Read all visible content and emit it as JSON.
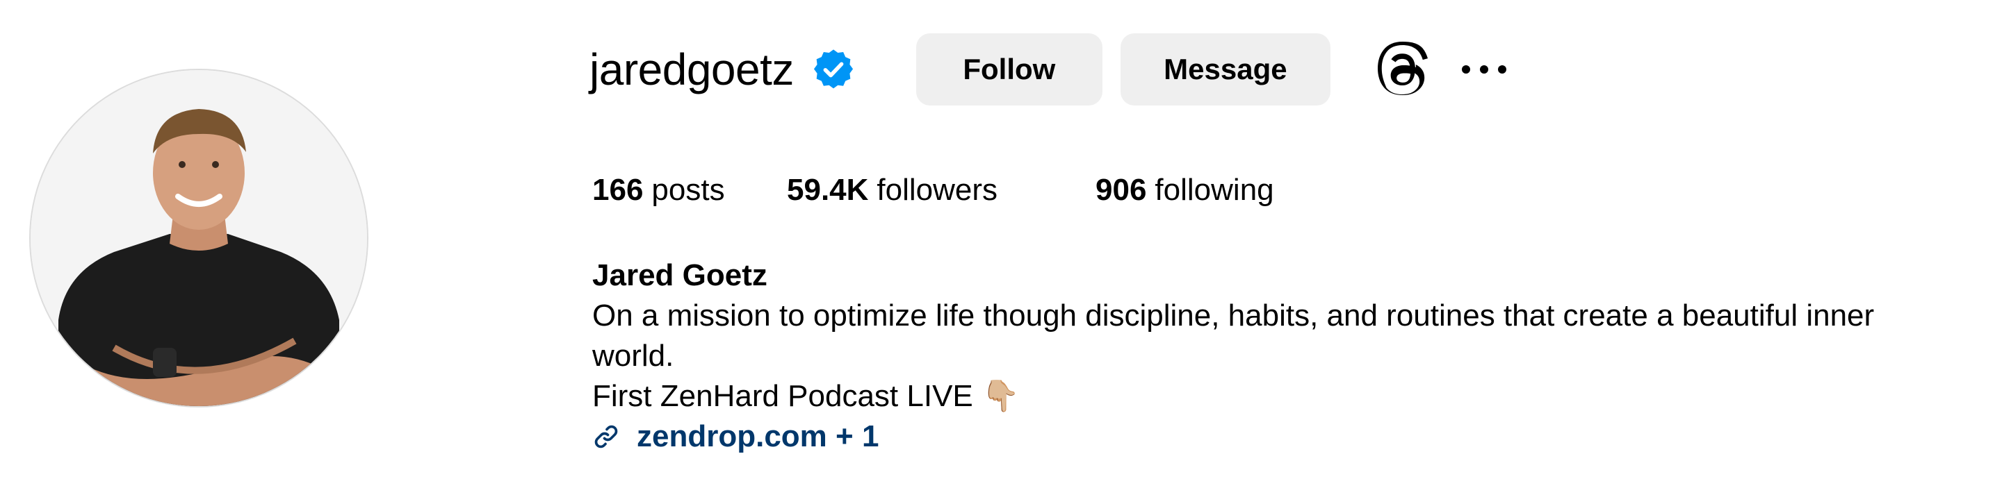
{
  "profile": {
    "username": "jaredgoetz",
    "verified": true,
    "avatar_alt": "profile-photo",
    "accent_color": "#0095f6",
    "link_color": "#00376b"
  },
  "actions": {
    "follow_label": "Follow",
    "message_label": "Message",
    "threads_icon": "threads-icon",
    "more_icon": "more-options-icon"
  },
  "stats": {
    "posts_count": "166",
    "posts_label": "posts",
    "followers_count": "59.4K",
    "followers_label": "followers",
    "following_count": "906",
    "following_label": "following"
  },
  "bio": {
    "full_name": "Jared Goetz",
    "line1": "On a mission to optimize life though discipline, habits, and routines that create a beautiful inner",
    "line2": "world.",
    "line3": "First ZenHard Podcast LIVE 👇🏼",
    "link_text": "zendrop.com + 1",
    "link_icon": "link-icon"
  }
}
